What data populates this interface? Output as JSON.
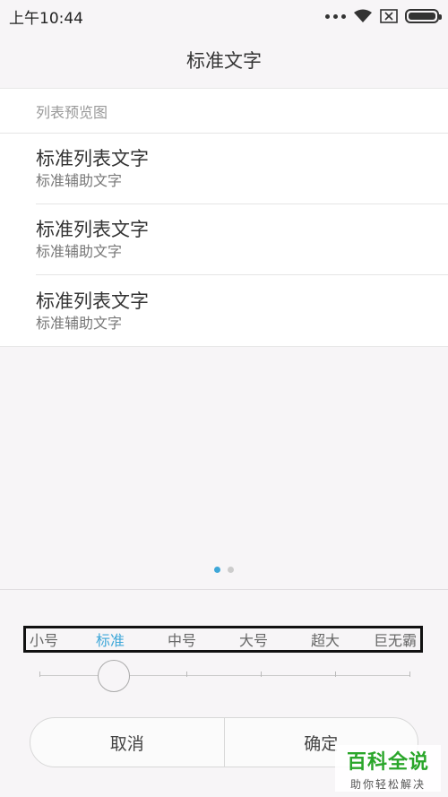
{
  "status_bar": {
    "time": "上午10:44",
    "icons": [
      "more-dots-icon",
      "wifi-icon",
      "sim-icon",
      "battery-icon"
    ]
  },
  "header": {
    "title": "标准文字"
  },
  "preview": {
    "header": "列表预览图",
    "items": [
      {
        "title": "标准列表文字",
        "subtitle": "标准辅助文字"
      },
      {
        "title": "标准列表文字",
        "subtitle": "标准辅助文字"
      },
      {
        "title": "标准列表文字",
        "subtitle": "标准辅助文字"
      }
    ]
  },
  "pager": {
    "count": 2,
    "active_index": 0
  },
  "font_size": {
    "options": [
      "小号",
      "标准",
      "中号",
      "大号",
      "超大",
      "巨无霸"
    ],
    "selected": "标准",
    "selected_index": 1
  },
  "actions": {
    "cancel": "取消",
    "confirm": "确定"
  },
  "watermark": {
    "title": "百科全说",
    "subtitle": "助你轻松解决"
  },
  "colors": {
    "accent": "#3ea7d8",
    "background": "#f7f5f7",
    "watermark_green": "#2aa62a"
  }
}
